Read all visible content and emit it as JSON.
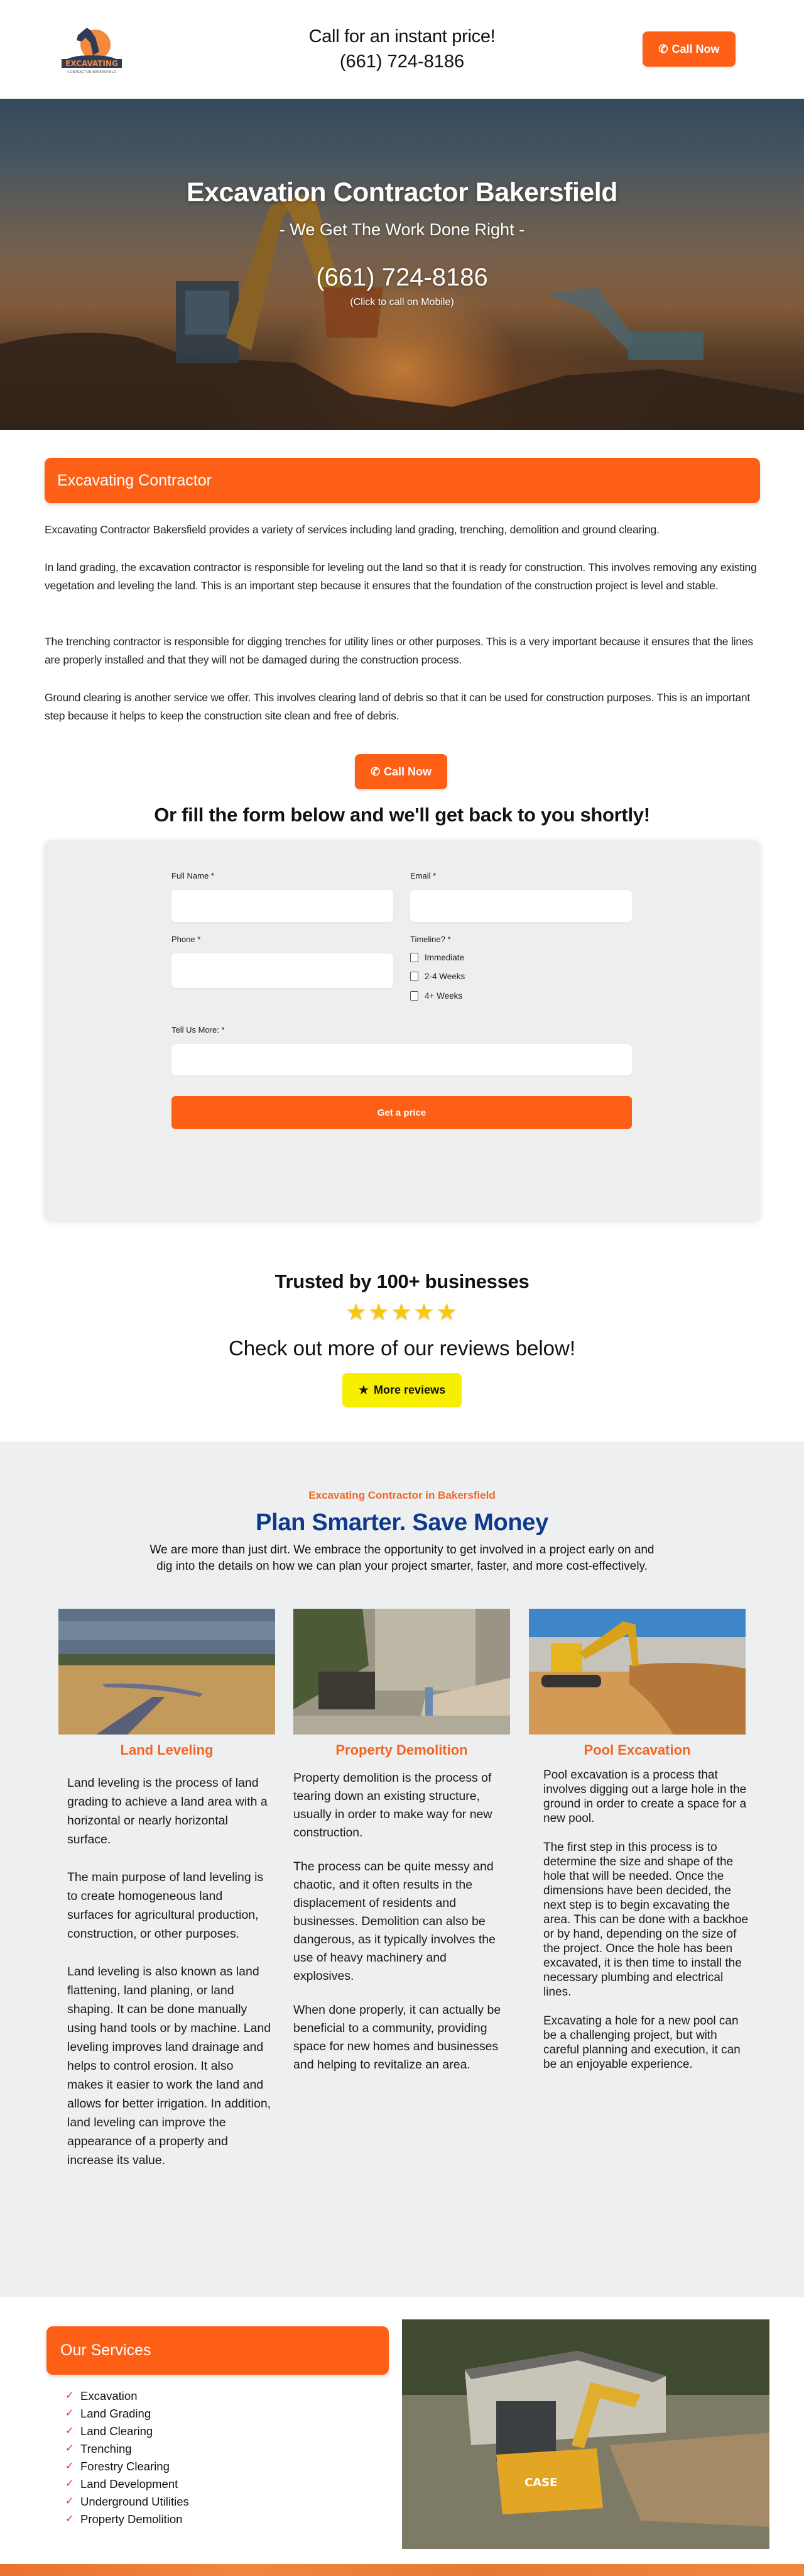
{
  "header": {
    "logo_text": "EXCAVATING",
    "logo_subtext": "CONTRACTOR BAKERSFIELD",
    "tagline": "Call for an instant price!",
    "phone": "(661) 724-8186",
    "call_button": "Call Now"
  },
  "hero": {
    "title": "Excavation Contractor Bakersfield",
    "subtitle": "- We Get The Work Done Right -",
    "phone": "(661) 724-8186",
    "phone_hint": "(Click to call on Mobile)"
  },
  "intro": {
    "banner": "Excavating Contractor",
    "paragraphs": [
      "Excavating Contractor Bakersfield provides a variety of services including land grading, trenching, demolition and ground clearing.",
      "In land grading, the excavation contractor is responsible for leveling out the land so that it is ready for construction. This involves removing any existing vegetation and leveling the land. This is an important step because it ensures that the foundation of the construction project is level and stable.",
      "The trenching contractor is responsible for digging trenches for utility lines or other purposes. This is a very important because it ensures that the lines are properly installed and that they will not be damaged during the construction process.",
      "Ground clearing is another service we offer. This involves clearing land of debris so that it can be used for construction purposes. This is an important step because it helps to keep the construction site clean and free of debris."
    ],
    "call_button": "Call Now"
  },
  "form": {
    "heading": "Or fill the form below and we'll get back to you shortly!",
    "full_name_label": "Full Name *",
    "full_name_value": "",
    "email_label": "Email *",
    "email_value": "",
    "phone_label": "Phone *",
    "phone_value": "",
    "timeline_label": "Timeline? *",
    "timeline_options": [
      "Immediate",
      "2-4 Weeks",
      "4+ Weeks"
    ],
    "message_label": "Tell Us More: *",
    "message_value": "",
    "submit": "Get a price"
  },
  "reviews": {
    "heading": "Trusted by 100+ businesses",
    "rating": 5,
    "rating_max": 5,
    "stars": "★★★★★",
    "subheading": "Check out more of our reviews below!",
    "button": "More reviews"
  },
  "plan": {
    "kicker": "Excavating Contractor in Bakersfield",
    "title": "Plan Smarter. Save Money",
    "description": "We are more than just dirt. We embrace the opportunity to get involved in a project early on and dig into the details on how we can plan your project smarter, faster, and more cost-effectively.",
    "services": [
      {
        "title": "Land Leveling",
        "paragraphs": [
          "Land leveling is the process of land grading to achieve a land area with a horizontal or nearly horizontal surface.",
          "The main purpose of land leveling is to create homogeneous land surfaces for agricultural production, construction, or other purposes.",
          "Land leveling is also known as land flattening, land planing, or land shaping. It can be done manually using hand tools or by machine. Land leveling improves land drainage and helps to control erosion. It also makes it easier to work the land and allows for better irrigation. In addition, land leveling can improve the appearance of a property and increase its value."
        ]
      },
      {
        "title": "Property Demolition",
        "paragraphs": [
          "Property demolition is the process of tearing down an existing structure, usually in order to make way for new construction.",
          "The process can be quite messy and chaotic, and it often results in the displacement of residents and businesses. Demolition can also be dangerous, as it typically involves the use of heavy machinery and explosives.",
          "When done properly, it can actually be beneficial to a community, providing space for new homes and businesses and helping to revitalize an area."
        ]
      },
      {
        "title": "Pool Excavation",
        "paragraphs": [
          "Pool excavation is a process that involves digging out a large hole in the ground in order to create a space for a new pool.",
          "The first step in this process is to determine the size and shape of the hole that will be needed. Once the dimensions have been decided, the next step is to begin excavating the area. This can be done with a backhoe or by hand, depending on the size of the project. Once the hole has been excavated, it is then time to install the necessary plumbing and electrical lines.",
          "Excavating a hole for a new pool can be a challenging project, but with careful planning and execution, it can be an enjoyable experience."
        ]
      }
    ]
  },
  "our_services": {
    "banner": "Our Services",
    "items": [
      "Excavation",
      "Land Grading",
      "Land Clearing",
      "Trenching",
      "Forestry Clearing",
      "Land Development",
      "Underground Utilities",
      "Property Demolition"
    ],
    "photo_label": "CASE"
  },
  "colors": {
    "accent_orange": "#fd5f17",
    "kicker_orange": "#f26522",
    "title_navy": "#0d3a8c",
    "review_yellow": "#f8ee00",
    "star_gold": "#f6c90e",
    "check_red": "#e8302a"
  }
}
